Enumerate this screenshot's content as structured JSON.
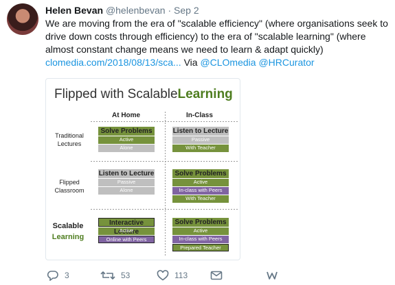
{
  "author": {
    "name": "Helen Bevan",
    "handle": "@helenbevan",
    "separator": "·",
    "date": "Sep 2"
  },
  "tweet": {
    "text_line1": "We are moving from the era of \"scalable efficiency\" (where organisations seek to",
    "text_line2": "drive down costs through efficiency) to the era of \"scalable learning\" (where",
    "text_line3": "almost constant change means we need to learn & adapt quickly)",
    "link": "clomedia.com/2018/08/13/sca...",
    "via": "Via",
    "mention1": "@CLOmedia",
    "mention2": "@HRCurator"
  },
  "slide": {
    "title_a": "Flipped with Scalable",
    "title_b": "Learning",
    "col_home": "At Home",
    "col_class": "In-Class",
    "rows": {
      "r1_a": "Traditional",
      "r1_b": "Lectures",
      "r2_a": "Flipped",
      "r2_b": "Classroom",
      "r3_a": "Scalable",
      "r3_b": "Learning"
    },
    "cells": {
      "r1_home": {
        "main": "Solve Problems",
        "b1": "Active",
        "b2": "Alone"
      },
      "r1_class": {
        "main": "Listen to Lecture",
        "b1": "Passive",
        "b2": "With Teacher"
      },
      "r2_home": {
        "main": "Listen to Lecture",
        "b1": "Passive",
        "b2": "Alone"
      },
      "r2_class": {
        "main": "Solve Problems",
        "b1": "Active",
        "b2": "In-class with Peers",
        "b3": "With Teacher"
      },
      "r3_home": {
        "main": "Interactive Lecture",
        "b1": "Active",
        "b2": "Online with Peers"
      },
      "r3_class": {
        "main": "Solve Problems",
        "b1": "Active",
        "b2": "In-class with Peers",
        "b3": "Prepared Teacher"
      }
    }
  },
  "actions": {
    "replies": "3",
    "retweets": "53",
    "likes": "113"
  },
  "colors": {
    "link": "#1b95e0",
    "green": "#76923c",
    "gray": "#bfbfbf",
    "purple": "#8064a2",
    "muted": "#657786"
  },
  "icons": [
    "reply-icon",
    "retweet-icon",
    "like-icon",
    "message-icon",
    "w-icon"
  ]
}
